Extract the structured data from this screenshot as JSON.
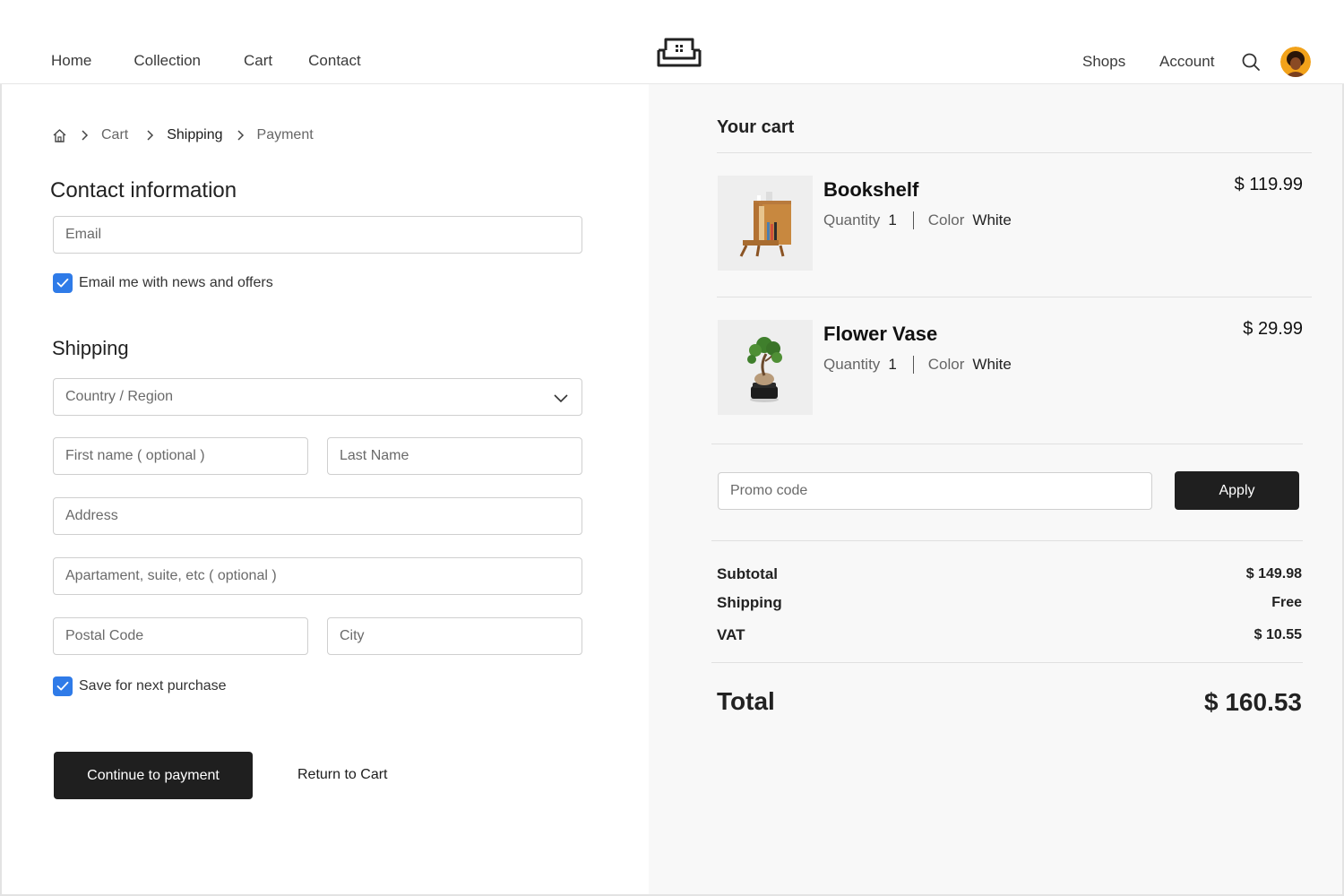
{
  "nav": {
    "left": [
      "Home",
      "Collection",
      "Cart",
      "Contact"
    ],
    "shops": "Shops",
    "account": "Account"
  },
  "breadcrumb": {
    "items": [
      "Cart",
      "Shipping",
      "Payment"
    ],
    "active": "Shipping"
  },
  "contact": {
    "title": "Contact information",
    "email_placeholder": "Email",
    "newsletter_label": "Email me with news and offers",
    "newsletter_checked": true
  },
  "shipping": {
    "title": "Shipping",
    "country_placeholder": "Country / Region",
    "first_name_placeholder": "First name ( optional )",
    "last_name_placeholder": "Last Name",
    "address_placeholder": "Address",
    "apartment_placeholder": "Apartament, suite, etc ( optional )",
    "postal_placeholder": "Postal Code",
    "city_placeholder": "City",
    "save_label": "Save for next purchase",
    "save_checked": true
  },
  "actions": {
    "continue_label": "Continue to payment",
    "return_label": "Return to Cart"
  },
  "cart": {
    "title": "Your cart",
    "items": [
      {
        "name": "Bookshelf",
        "quantity_label": "Quantity",
        "quantity": "1",
        "color_label": "Color",
        "color": "White",
        "price": "$  119.99"
      },
      {
        "name": "Flower Vase",
        "quantity_label": "Quantity",
        "quantity": "1",
        "color_label": "Color",
        "color": "White",
        "price": "$  29.99"
      }
    ],
    "promo_placeholder": "Promo code",
    "apply_label": "Apply",
    "summary": {
      "subtotal_label": "Subtotal",
      "subtotal_value": "$  149.98",
      "shipping_label": "Shipping",
      "shipping_value": "Free",
      "vat_label": "VAT",
      "vat_value": "$ 10.55",
      "total_label": "Total",
      "total_value": "$ 160.53"
    }
  },
  "colors": {
    "accent": "#2f7be8",
    "dark_button": "#1f1f1f",
    "panel_bg": "#f8f8f8"
  },
  "icons": {
    "logo": "sofa-logo-icon",
    "search": "search-icon",
    "home": "home-icon",
    "chevron": "chevron-right-icon",
    "dropdown": "chevron-down-icon",
    "check": "check-icon"
  }
}
